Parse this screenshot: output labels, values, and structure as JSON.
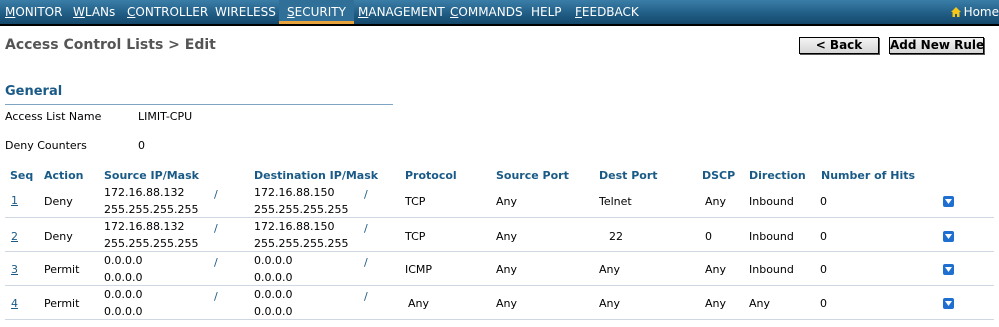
{
  "nav": {
    "items": [
      {
        "key": "M",
        "rest": "ONITOR"
      },
      {
        "key": "W",
        "rest": "LANs"
      },
      {
        "key": "C",
        "rest": "ONTROLLER"
      },
      {
        "key": "",
        "rest": "WIRELESS"
      },
      {
        "key": "S",
        "rest": "ECURITY"
      },
      {
        "key": "M",
        "rest": "ANAGEMENT"
      },
      {
        "key": "C",
        "rest": "OMMANDS"
      },
      {
        "key": "",
        "rest": "HELP"
      },
      {
        "key": "F",
        "rest": "EEDBACK"
      }
    ],
    "home_label": "Home",
    "active": "SECURITY"
  },
  "page": {
    "title": "Access Control Lists > Edit",
    "back_label": "< Back",
    "add_label": "Add New Rule"
  },
  "general": {
    "title": "General",
    "name_label": "Access List Name",
    "name_value": "LIMIT-CPU",
    "deny_label": "Deny Counters",
    "deny_value": "0"
  },
  "table": {
    "headers": [
      "Seq",
      "Action",
      "Source IP/Mask",
      "Destination IP/Mask",
      "Protocol",
      "Source Port",
      "Dest Port",
      "DSCP",
      "Direction",
      "Number of Hits"
    ],
    "rows": [
      {
        "seq": "1",
        "action": "Deny",
        "src_ip": "172.16.88.132",
        "src_mask": "255.255.255.255",
        "dst_ip": "172.16.88.150",
        "dst_mask": "255.255.255.255",
        "protocol": "TCP",
        "src_port": "Any",
        "dst_port": "Telnet",
        "dscp": "Any",
        "direction": "Inbound",
        "hits": "0"
      },
      {
        "seq": "2",
        "action": "Deny",
        "src_ip": "172.16.88.132",
        "src_mask": "255.255.255.255",
        "dst_ip": "172.16.88.150",
        "dst_mask": "255.255.255.255",
        "protocol": "TCP",
        "src_port": "Any",
        "dst_port": "22",
        "dscp": "0",
        "direction": "Inbound",
        "hits": "0"
      },
      {
        "seq": "3",
        "action": "Permit",
        "src_ip": "0.0.0.0",
        "src_mask": "0.0.0.0",
        "dst_ip": "0.0.0.0",
        "dst_mask": "0.0.0.0",
        "protocol": "ICMP",
        "src_port": "Any",
        "dst_port": "Any",
        "dscp": "Any",
        "direction": "Inbound",
        "hits": "0"
      },
      {
        "seq": "4",
        "action": "Permit",
        "src_ip": "0.0.0.0",
        "src_mask": "0.0.0.0",
        "dst_ip": "0.0.0.0",
        "dst_mask": "0.0.0.0",
        "protocol": "Any",
        "src_port": "Any",
        "dst_port": "Any",
        "dscp": "Any",
        "direction": "Any",
        "hits": "0"
      }
    ],
    "slash": "/"
  },
  "colors": {
    "nav_bg": "#1f5b83",
    "header_text": "#1a5a86",
    "active_underline": "#e8a33d",
    "dropdown_icon": "#1f6fd0"
  }
}
